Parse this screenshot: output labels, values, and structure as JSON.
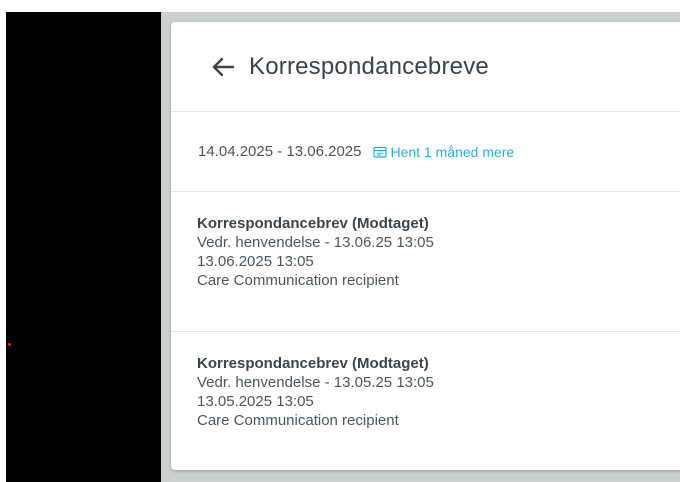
{
  "header": {
    "title": "Korrespondancebreve",
    "back_icon": "arrow-left-icon"
  },
  "range": {
    "dates": "14.04.2025 - 13.06.2025",
    "fetch_label": "Hent 1 måned mere",
    "fetch_icon": "calendar-icon"
  },
  "letters": [
    {
      "title": "Korrespondancebrev (Modtaget)",
      "subject": "Vedr. henvendelse - 13.06.25 13:05",
      "datetime": "13.06.2025 13:05",
      "recipient": "Care Communication recipient"
    },
    {
      "title": "Korrespondancebrev (Modtaget)",
      "subject": "Vedr. henvendelse - 13.05.25 13:05",
      "datetime": "13.05.2025 13:05",
      "recipient": "Care Communication recipient"
    }
  ],
  "colors": {
    "link": "#2eaee0",
    "title_text": "#3b4348",
    "body_text": "#4d555a",
    "backdrop": "#cdd0d1"
  }
}
